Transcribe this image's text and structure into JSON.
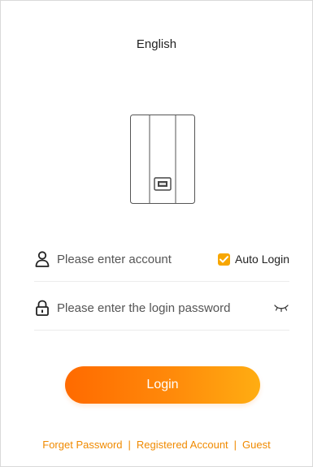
{
  "language": "English",
  "account_field": {
    "placeholder": "Please enter account",
    "value": "",
    "icon": "user-icon"
  },
  "auto_login": {
    "label": "Auto Login",
    "checked": true
  },
  "password_field": {
    "placeholder": "Please enter the login password",
    "value": "",
    "icon": "lock-icon",
    "toggle_icon": "eye-closed-icon"
  },
  "login_button": {
    "label": "Login"
  },
  "footer_links": {
    "forget_password": "Forget Password",
    "register": "Registered Account",
    "guest": "Guest",
    "separator": "|"
  },
  "colors": {
    "accent": "#f7a600",
    "button_start": "#ff6a00",
    "button_end": "#ffad12",
    "link": "#f08a00"
  }
}
